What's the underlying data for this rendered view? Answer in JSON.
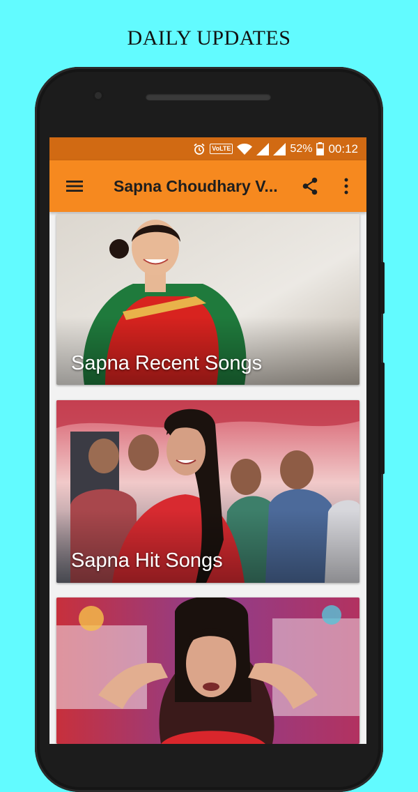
{
  "promo": {
    "title": "DAILY UPDATES"
  },
  "status_bar": {
    "volte": "VoLTE",
    "battery": "52%",
    "time": "00:12"
  },
  "app_bar": {
    "title": "Sapna Choudhary V...",
    "menu_icon": "hamburger-menu-icon",
    "share_icon": "share-icon",
    "overflow_icon": "more-vert-icon"
  },
  "cards": [
    {
      "label": "Sapna Recent Songs"
    },
    {
      "label": "Sapna Hit Songs"
    },
    {
      "label": ""
    }
  ],
  "colors": {
    "background": "#62fbff",
    "status_bar": "#d16a13",
    "app_bar": "#f6891f"
  }
}
